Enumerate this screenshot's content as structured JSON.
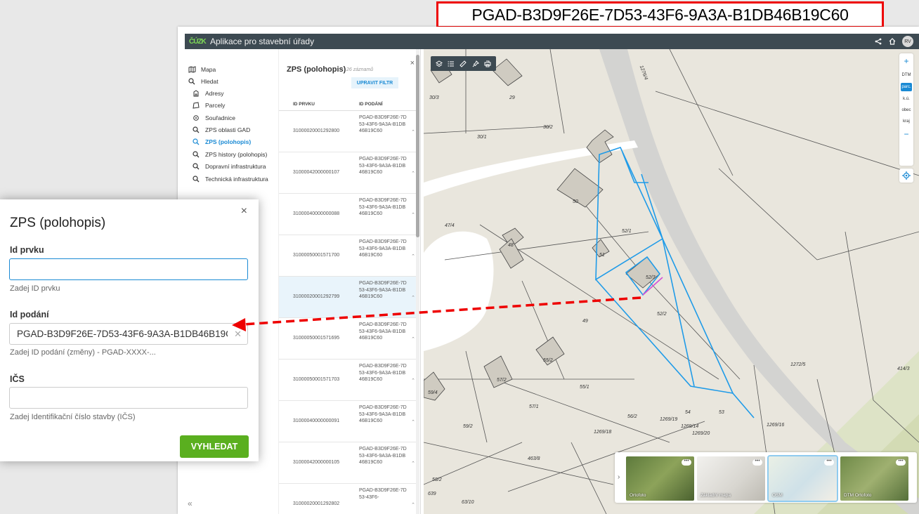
{
  "callout": {
    "pgad": "PGAD-B3D9F26E-7D53-43F6-9A3A-B1DB46B19C60"
  },
  "app": {
    "logo": "ČÚZK",
    "title": "Aplikace pro stavební úřady",
    "avatar": "RV"
  },
  "nav": {
    "items": [
      {
        "label": "Mapa"
      },
      {
        "label": "Hledat"
      },
      {
        "label": "Adresy"
      },
      {
        "label": "Parcely"
      },
      {
        "label": "Souřadnice"
      },
      {
        "label": "ZPS oblasti GAD"
      },
      {
        "label": "ZPS (polohopis)"
      },
      {
        "label": "ZPS history (polohopis)"
      },
      {
        "label": "Dopravní infrastruktura"
      },
      {
        "label": "Technická infrastruktura"
      }
    ],
    "collapse": "«"
  },
  "list": {
    "title": "ZPS (polohopis)",
    "count": "26 záznamů",
    "filter_button": "UPRAVIT FILTR",
    "col_id": "ID PRVKU",
    "col_pod": "ID PODÁNÍ",
    "rows": [
      {
        "id": "31000020001292800",
        "pod": "PGAD-B3D9F26E-7D53-43F6-9A3A-B1DB46B19C60"
      },
      {
        "id": "31000042000000107",
        "pod": "PGAD-B3D9F26E-7D53-43F6-9A3A-B1DB46B19C60"
      },
      {
        "id": "31000040000000088",
        "pod": "PGAD-B3D9F26E-7D53-43F6-9A3A-B1DB46B19C60"
      },
      {
        "id": "31000050001571700",
        "pod": "PGAD-B3D9F26E-7D53-43F6-9A3A-B1DB46B19C60"
      },
      {
        "id": "31000020001292799",
        "pod": "PGAD-B3D9F26E-7D53-43F6-9A3A-B1DB46B19C60"
      },
      {
        "id": "31000050001571695",
        "pod": "PGAD-B3D9F26E-7D53-43F6-9A3A-B1DB46B19C60"
      },
      {
        "id": "31000050001571703",
        "pod": "PGAD-B3D9F26E-7D53-43F6-9A3A-B1DB46B19C60"
      },
      {
        "id": "31000040000000091",
        "pod": "PGAD-B3D9F26E-7D53-43F6-9A3A-B1DB46B19C60"
      },
      {
        "id": "31000042000000105",
        "pod": "PGAD-B3D9F26E-7D53-43F6-9A3A-B1DB46B19C60"
      },
      {
        "id": "31000020001292802",
        "pod": "PGAD-B3D9F26E-7D53-43F6-"
      }
    ]
  },
  "map": {
    "zoom_in": "+",
    "zoom_out": "−",
    "levels": [
      "DTM",
      "parc.",
      "k.ú.",
      "obec",
      "kraj"
    ],
    "labels": [
      "30/3",
      "29",
      "30/2",
      "30/1",
      "1276/4",
      "50",
      "52/1",
      "48",
      "51",
      "47/4",
      "52/3",
      "49",
      "52/2",
      "55/2",
      "57/2",
      "55/1",
      "59/4",
      "57/1",
      "54",
      "53",
      "1272/5",
      "414/3",
      "56/2",
      "1269/19",
      "1269/14",
      "1269/20",
      "1269/18",
      "1269/16",
      "59/2",
      "58/2",
      "63/10",
      "639",
      "463/8"
    ],
    "basemap_prev": "›",
    "basemaps": [
      {
        "label": "Ortofoto"
      },
      {
        "label": "Základní mapa"
      },
      {
        "label": "OSM"
      },
      {
        "label": "DTM Ortofoto"
      }
    ],
    "more": "•••"
  },
  "popup": {
    "title": "ZPS (polohopis)",
    "close": "×",
    "id_label": "Id prvku",
    "id_value": "",
    "id_help": "Zadej ID prvku",
    "pod_label": "Id podání",
    "pod_value": "PGAD-B3D9F26E-7D53-43F6-9A3A-B1DB46B19C60",
    "pod_help": "Zadej ID podání (změny) - PGAD-XXXX-...",
    "ics_label": "IČS",
    "ics_value": "",
    "ics_help": "Zadej Identifikační číslo stavby (IČS)",
    "search_button": "VYHLEDAT"
  },
  "colors": {
    "accent": "#1a8ad4",
    "button": "#5aaf1f",
    "callout": "#e00000"
  }
}
